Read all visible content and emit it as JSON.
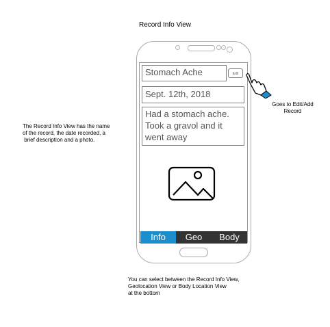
{
  "title": "Record Info View",
  "record": {
    "name": "Stomach Ache",
    "edit_label": "Edit",
    "date": "Sept. 12th, 2018",
    "description_lines": [
      "Had a stomach ache.",
      "Took a gravol and it",
      "went away"
    ]
  },
  "tabs": [
    {
      "label": "Info",
      "active": true
    },
    {
      "label": "Geo",
      "active": false
    },
    {
      "label": "Body",
      "active": false
    }
  ],
  "notes": {
    "left": [
      "The Record Info View has the name",
      "of the record, the date recorded, a",
      " brief description and a photo."
    ],
    "right": [
      "Goes to Edit/Add",
      "Record"
    ],
    "bottom": [
      "You can select between the Record Info View,",
      "Geolocation View or Body Location View",
      "at the bottom"
    ]
  },
  "colors": {
    "active_tab": "#1b8fce",
    "tab": "#333333",
    "hand_cuff": "#1b8fce"
  },
  "icons": {
    "photo": "image-placeholder-icon",
    "pointer": "pointing-hand-icon"
  }
}
